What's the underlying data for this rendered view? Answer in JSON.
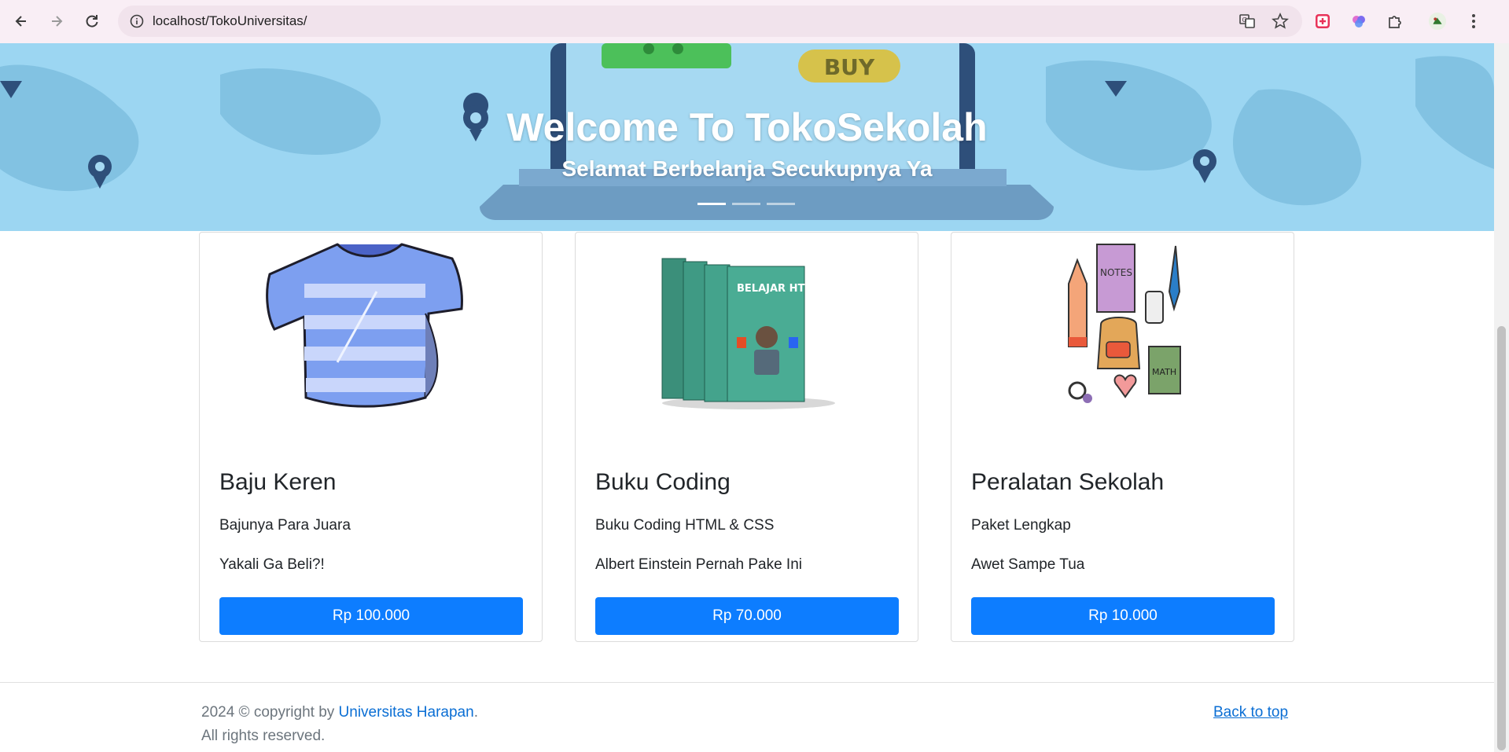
{
  "browser": {
    "url": "localhost/TokoUniversitas/"
  },
  "hero": {
    "title": "Welcome To TokoSekolah",
    "subtitle": "Selamat Berbelanja Secukupnya Ya",
    "illustration_text": "BUY",
    "slides": 3,
    "active_slide": 1
  },
  "products": [
    {
      "name": "Baju Keren",
      "description": "Bajunya Para Juara",
      "note": "Yakali Ga Beli?!",
      "price": "Rp 100.000",
      "image": "striped-shirt"
    },
    {
      "name": "Buku Coding",
      "description": "Buku Coding HTML & CSS",
      "note": "Albert Einstein Pernah Pake Ini",
      "price": "Rp 70.000",
      "image": "coding-books",
      "book_text": "BELAJAR HTML & CSS DASAR"
    },
    {
      "name": "Peralatan Sekolah",
      "description": "Paket Lengkap",
      "note": "Awet Sampe Tua",
      "price": "Rp 10.000",
      "image": "school-supplies",
      "labels": [
        "NOTES",
        "MATH",
        "ERASER"
      ]
    }
  ],
  "footer": {
    "copyright_prefix": "2024 © copyright by ",
    "copyright_link": "Universitas Harapan",
    "copyright_suffix": ".",
    "rights": "All rights reserved.",
    "back_to_top": "Back to top"
  },
  "colors": {
    "primary": "#0d7dff",
    "hero_bg": "#9cd6f2",
    "link": "#0a6ed4"
  }
}
